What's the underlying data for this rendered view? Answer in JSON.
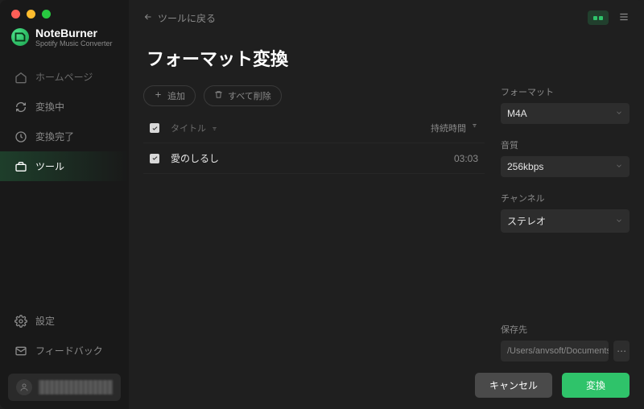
{
  "brand": {
    "name": "NoteBurner",
    "subtitle": "Spotify Music Converter"
  },
  "sidebar": {
    "items": [
      {
        "label": "ホームページ"
      },
      {
        "label": "変換中"
      },
      {
        "label": "変換完了"
      },
      {
        "label": "ツール"
      }
    ],
    "bottom": [
      {
        "label": "設定"
      },
      {
        "label": "フィードバック"
      }
    ]
  },
  "topbar": {
    "back_label": "ツールに戻る"
  },
  "page": {
    "title": "フォーマット変換"
  },
  "actions": {
    "add": "追加",
    "remove_all": "すべて削除"
  },
  "table": {
    "cols": {
      "title": "タイトル",
      "duration": "持続時間"
    },
    "rows": [
      {
        "title": "愛のしるし",
        "duration": "03:03"
      }
    ]
  },
  "settings": {
    "format": {
      "label": "フォーマット",
      "value": "M4A"
    },
    "bitrate": {
      "label": "音質",
      "value": "256kbps"
    },
    "channel": {
      "label": "チャンネル",
      "value": "ステレオ"
    },
    "output": {
      "label": "保存先",
      "value": "/Users/anvsoft/Documents/"
    }
  },
  "footer": {
    "cancel": "キャンセル",
    "convert": "変換"
  }
}
